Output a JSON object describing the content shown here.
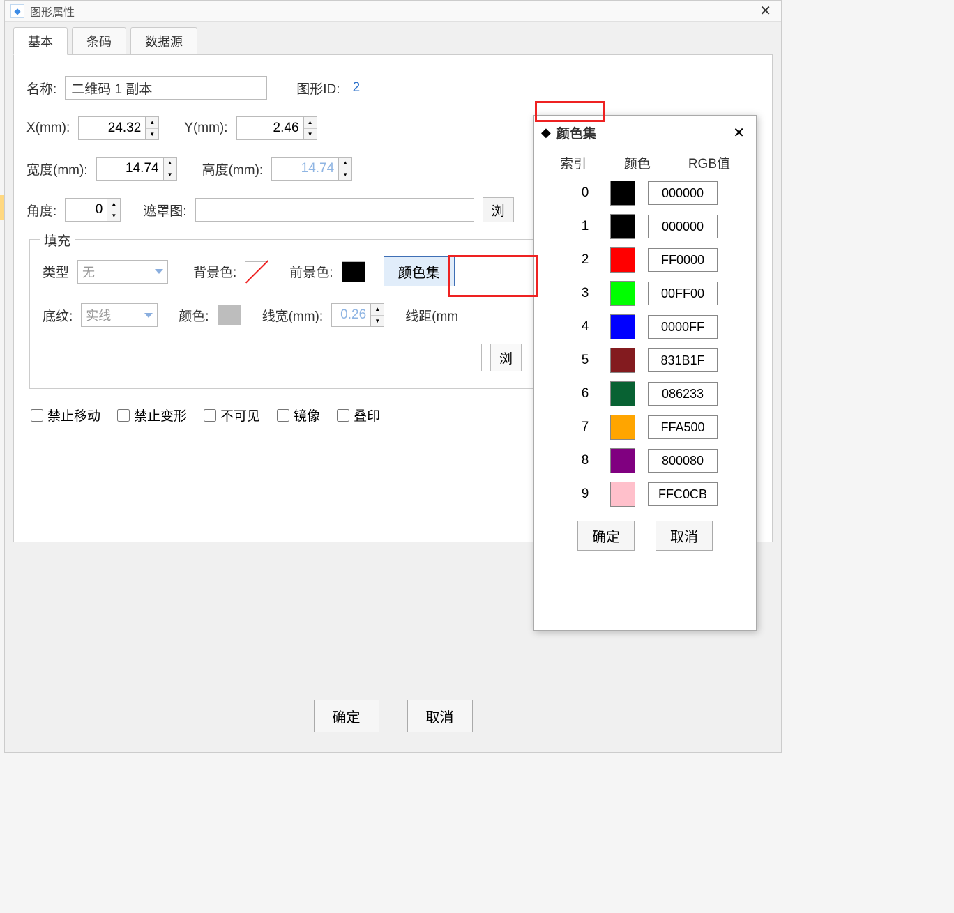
{
  "window": {
    "title": "图形属性"
  },
  "tabs": {
    "basic": "基本",
    "barcode": "条码",
    "datasource": "数据源"
  },
  "basic": {
    "name_label": "名称:",
    "name_value": "二维码 1 副本",
    "shapeid_label": "图形ID:",
    "shapeid_value": "2",
    "x_label": "X(mm):",
    "x_value": "24.32",
    "y_label": "Y(mm):",
    "y_value": "2.46",
    "width_label": "宽度(mm):",
    "width_value": "14.74",
    "height_label": "高度(mm):",
    "height_value": "14.74",
    "angle_label": "角度:",
    "angle_value": "0",
    "mask_label": "遮罩图:",
    "mask_browse": "浏"
  },
  "fill": {
    "legend": "填充",
    "type_label": "类型",
    "type_value": "无",
    "bgcolor_label": "背景色:",
    "fgcolor_label": "前景色:",
    "colorset_btn": "颜色集",
    "pattern_label": "底纹:",
    "pattern_value": "实线",
    "color_label": "颜色:",
    "linewidth_label": "线宽(mm):",
    "linewidth_value": "0.26",
    "linedist_label": "线距(mm",
    "browse_btn": "浏"
  },
  "checkboxes": {
    "cb1": "禁止移动",
    "cb2": "禁止变形",
    "cb3": "不可见",
    "cb4": "镜像",
    "cb5": "叠印"
  },
  "buttons": {
    "ok": "确定",
    "cancel": "取消"
  },
  "colorDialog": {
    "title": "颜色集",
    "headers": {
      "index": "索引",
      "color": "颜色",
      "rgb": "RGB值"
    },
    "rows": [
      {
        "index": "0",
        "hex": "#000000",
        "rgb": "000000"
      },
      {
        "index": "1",
        "hex": "#000000",
        "rgb": "000000"
      },
      {
        "index": "2",
        "hex": "#FF0000",
        "rgb": "FF0000"
      },
      {
        "index": "3",
        "hex": "#00FF00",
        "rgb": "00FF00"
      },
      {
        "index": "4",
        "hex": "#0000FF",
        "rgb": "0000FF"
      },
      {
        "index": "5",
        "hex": "#831B1F",
        "rgb": "831B1F"
      },
      {
        "index": "6",
        "hex": "#086233",
        "rgb": "086233"
      },
      {
        "index": "7",
        "hex": "#FFA500",
        "rgb": "FFA500"
      },
      {
        "index": "8",
        "hex": "#800080",
        "rgb": "800080"
      },
      {
        "index": "9",
        "hex": "#FFC0CB",
        "rgb": "FFC0CB"
      }
    ],
    "ok": "确定",
    "cancel": "取消"
  }
}
